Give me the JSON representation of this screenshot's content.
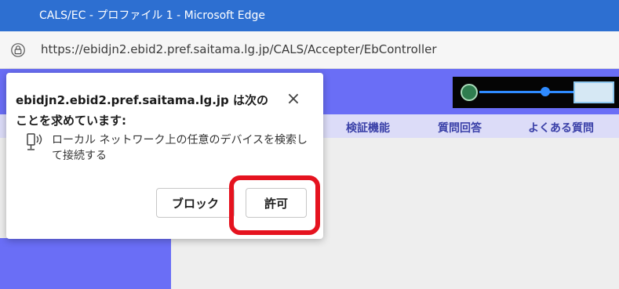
{
  "window": {
    "title": "CALS/EC - プロファイル 1 - Microsoft Edge"
  },
  "address_bar": {
    "url": "https://ebidjn2.ebid2.pref.saitama.lg.jp/CALS/Accepter/EbController",
    "icon": "lock-icon"
  },
  "page": {
    "nav": [
      {
        "label": "検証機能"
      },
      {
        "label": "質問回答"
      },
      {
        "label": "よくある質問"
      }
    ],
    "colors": {
      "banner": "#6a6ef6",
      "nav_text": "#3a40a8",
      "nav_bg": "#dcdcf8"
    }
  },
  "permission_dialog": {
    "title": "ebidjn2.ebid2.pref.saitama.lg.jp は次のことを求めています:",
    "description": "ローカル ネットワーク上の任意のデバイスを検索して接続する",
    "close_label": "×",
    "block_label": "ブロック",
    "allow_label": "許可"
  },
  "annotation": {
    "color": "#e5131f"
  }
}
